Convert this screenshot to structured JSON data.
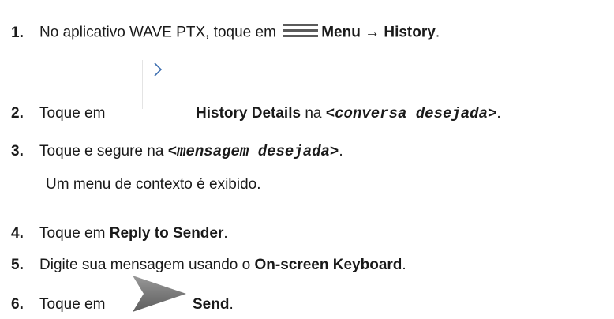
{
  "steps": [
    {
      "number": "1.",
      "text_a": "No aplicativo WAVE PTX, toque em",
      "icon": "hamburger-menu-icon",
      "bold_a": "Menu",
      "arrow": "→",
      "bold_b": "History",
      "end": "."
    },
    {
      "number": "2.",
      "text_a": "Toque em",
      "icon": "chevron-right-icon",
      "bold_a": "History Details",
      "text_b": "na",
      "var": "<conversa desejada>",
      "end": "."
    },
    {
      "number": "3.",
      "text_a": "Toque e segure na",
      "var": "<mensagem desejada>",
      "end": ".",
      "note": "Um menu de contexto é exibido."
    },
    {
      "number": "4.",
      "text_a": "Toque em",
      "bold_a": "Reply to Sender",
      "end": "."
    },
    {
      "number": "5.",
      "text_a": "Digite sua mensagem usando o",
      "bold_a": "On-screen Keyboard",
      "end": "."
    },
    {
      "number": "6.",
      "text_a": "Toque em",
      "icon": "send-arrow-icon",
      "bold_a": "Send",
      "end": "."
    }
  ]
}
